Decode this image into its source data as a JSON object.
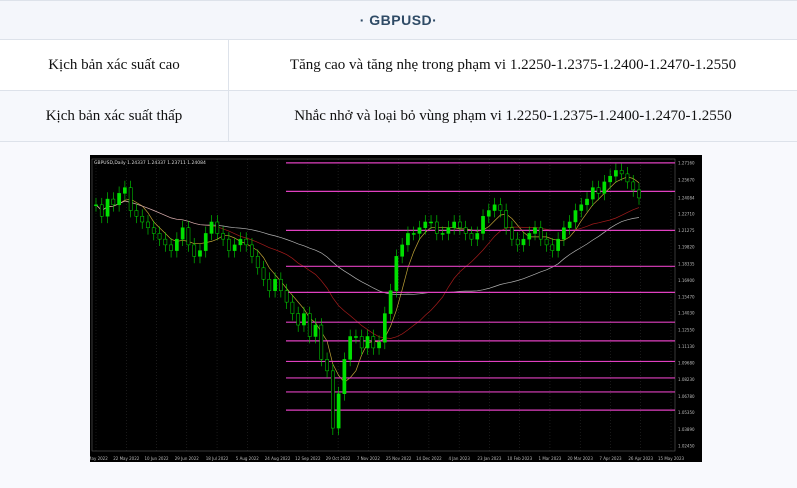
{
  "header": {
    "title": "· GBPUSD·"
  },
  "scenarios": [
    {
      "label": "Kịch bản xác suất cao",
      "text": "Tăng cao và tăng nhẹ trong phạm vi 1.2250-1.2375-1.2400-1.2470-1.2550"
    },
    {
      "label": "Kịch bản xác suất thấp",
      "text": "Nhắc nhở và loại bỏ vùng phạm vi 1.2250-1.2375-1.2400-1.2470-1.2550"
    }
  ],
  "chart_data": {
    "type": "candlestick",
    "title": "GBPUSD,Daily 1.24337 1.24337 1.23711 1.24084",
    "x_tick_labels": [
      "5 May 2022",
      "22 May 2022",
      "10 Jun 2022",
      "29 Jun 2022",
      "18 Jul 2022",
      "5 Aug 2022",
      "24 Aug 2022",
      "12 Sep 2022",
      "29 Oct 2022",
      "7 Nov 2022",
      "25 Nov 2022",
      "14 Dec 2022",
      "4 Jan 2023",
      "23 Jan 2023",
      "10 Feb 2023",
      "1 Mar 2023",
      "20 Mar 2023",
      "7 Apr 2023",
      "26 Apr 2023",
      "15 May 2023"
    ],
    "y_tick_labels": [
      "1.27160",
      "1.25670",
      "1.24084",
      "1.22710",
      "1.21275",
      "1.19820",
      "1.18335",
      "1.16900",
      "1.15470",
      "1.14030",
      "1.12550",
      "1.11130",
      "1.09680",
      "1.08230",
      "1.06780",
      "1.05350",
      "1.03890",
      "1.02450"
    ],
    "ylim": [
      1.02,
      1.275
    ],
    "horizontal_levels": [
      1.2716,
      1.2467,
      1.2127,
      1.1813,
      1.1585,
      1.1325,
      1.1162,
      1.0982,
      1.0838,
      1.0716,
      1.0557
    ],
    "colors": {
      "background": "#000000",
      "candles": "#00e000",
      "levels": "#e040c0",
      "grid": "#404040"
    },
    "close_path": [
      1.235,
      1.225,
      1.24,
      1.235,
      1.245,
      1.25,
      1.23,
      1.225,
      1.22,
      1.215,
      1.21,
      1.205,
      1.2,
      1.195,
      1.205,
      1.215,
      1.2,
      1.19,
      1.195,
      1.21,
      1.22,
      1.21,
      1.205,
      1.195,
      1.2,
      1.205,
      1.2,
      1.19,
      1.18,
      1.17,
      1.16,
      1.17,
      1.16,
      1.15,
      1.14,
      1.13,
      1.14,
      1.12,
      1.13,
      1.1,
      1.09,
      1.04,
      1.07,
      1.1,
      1.12,
      1.12,
      1.11,
      1.12,
      1.11,
      1.115,
      1.14,
      1.16,
      1.19,
      1.2,
      1.21,
      1.21,
      1.215,
      1.22,
      1.22,
      1.21,
      1.21,
      1.215,
      1.22,
      1.215,
      1.21,
      1.205,
      1.21,
      1.225,
      1.23,
      1.235,
      1.23,
      1.215,
      1.205,
      1.2,
      1.205,
      1.21,
      1.215,
      1.205,
      1.2,
      1.195,
      1.205,
      1.215,
      1.22,
      1.23,
      1.235,
      1.24,
      1.25,
      1.245,
      1.255,
      1.26,
      1.265,
      1.262,
      1.255,
      1.248,
      1.241
    ]
  }
}
